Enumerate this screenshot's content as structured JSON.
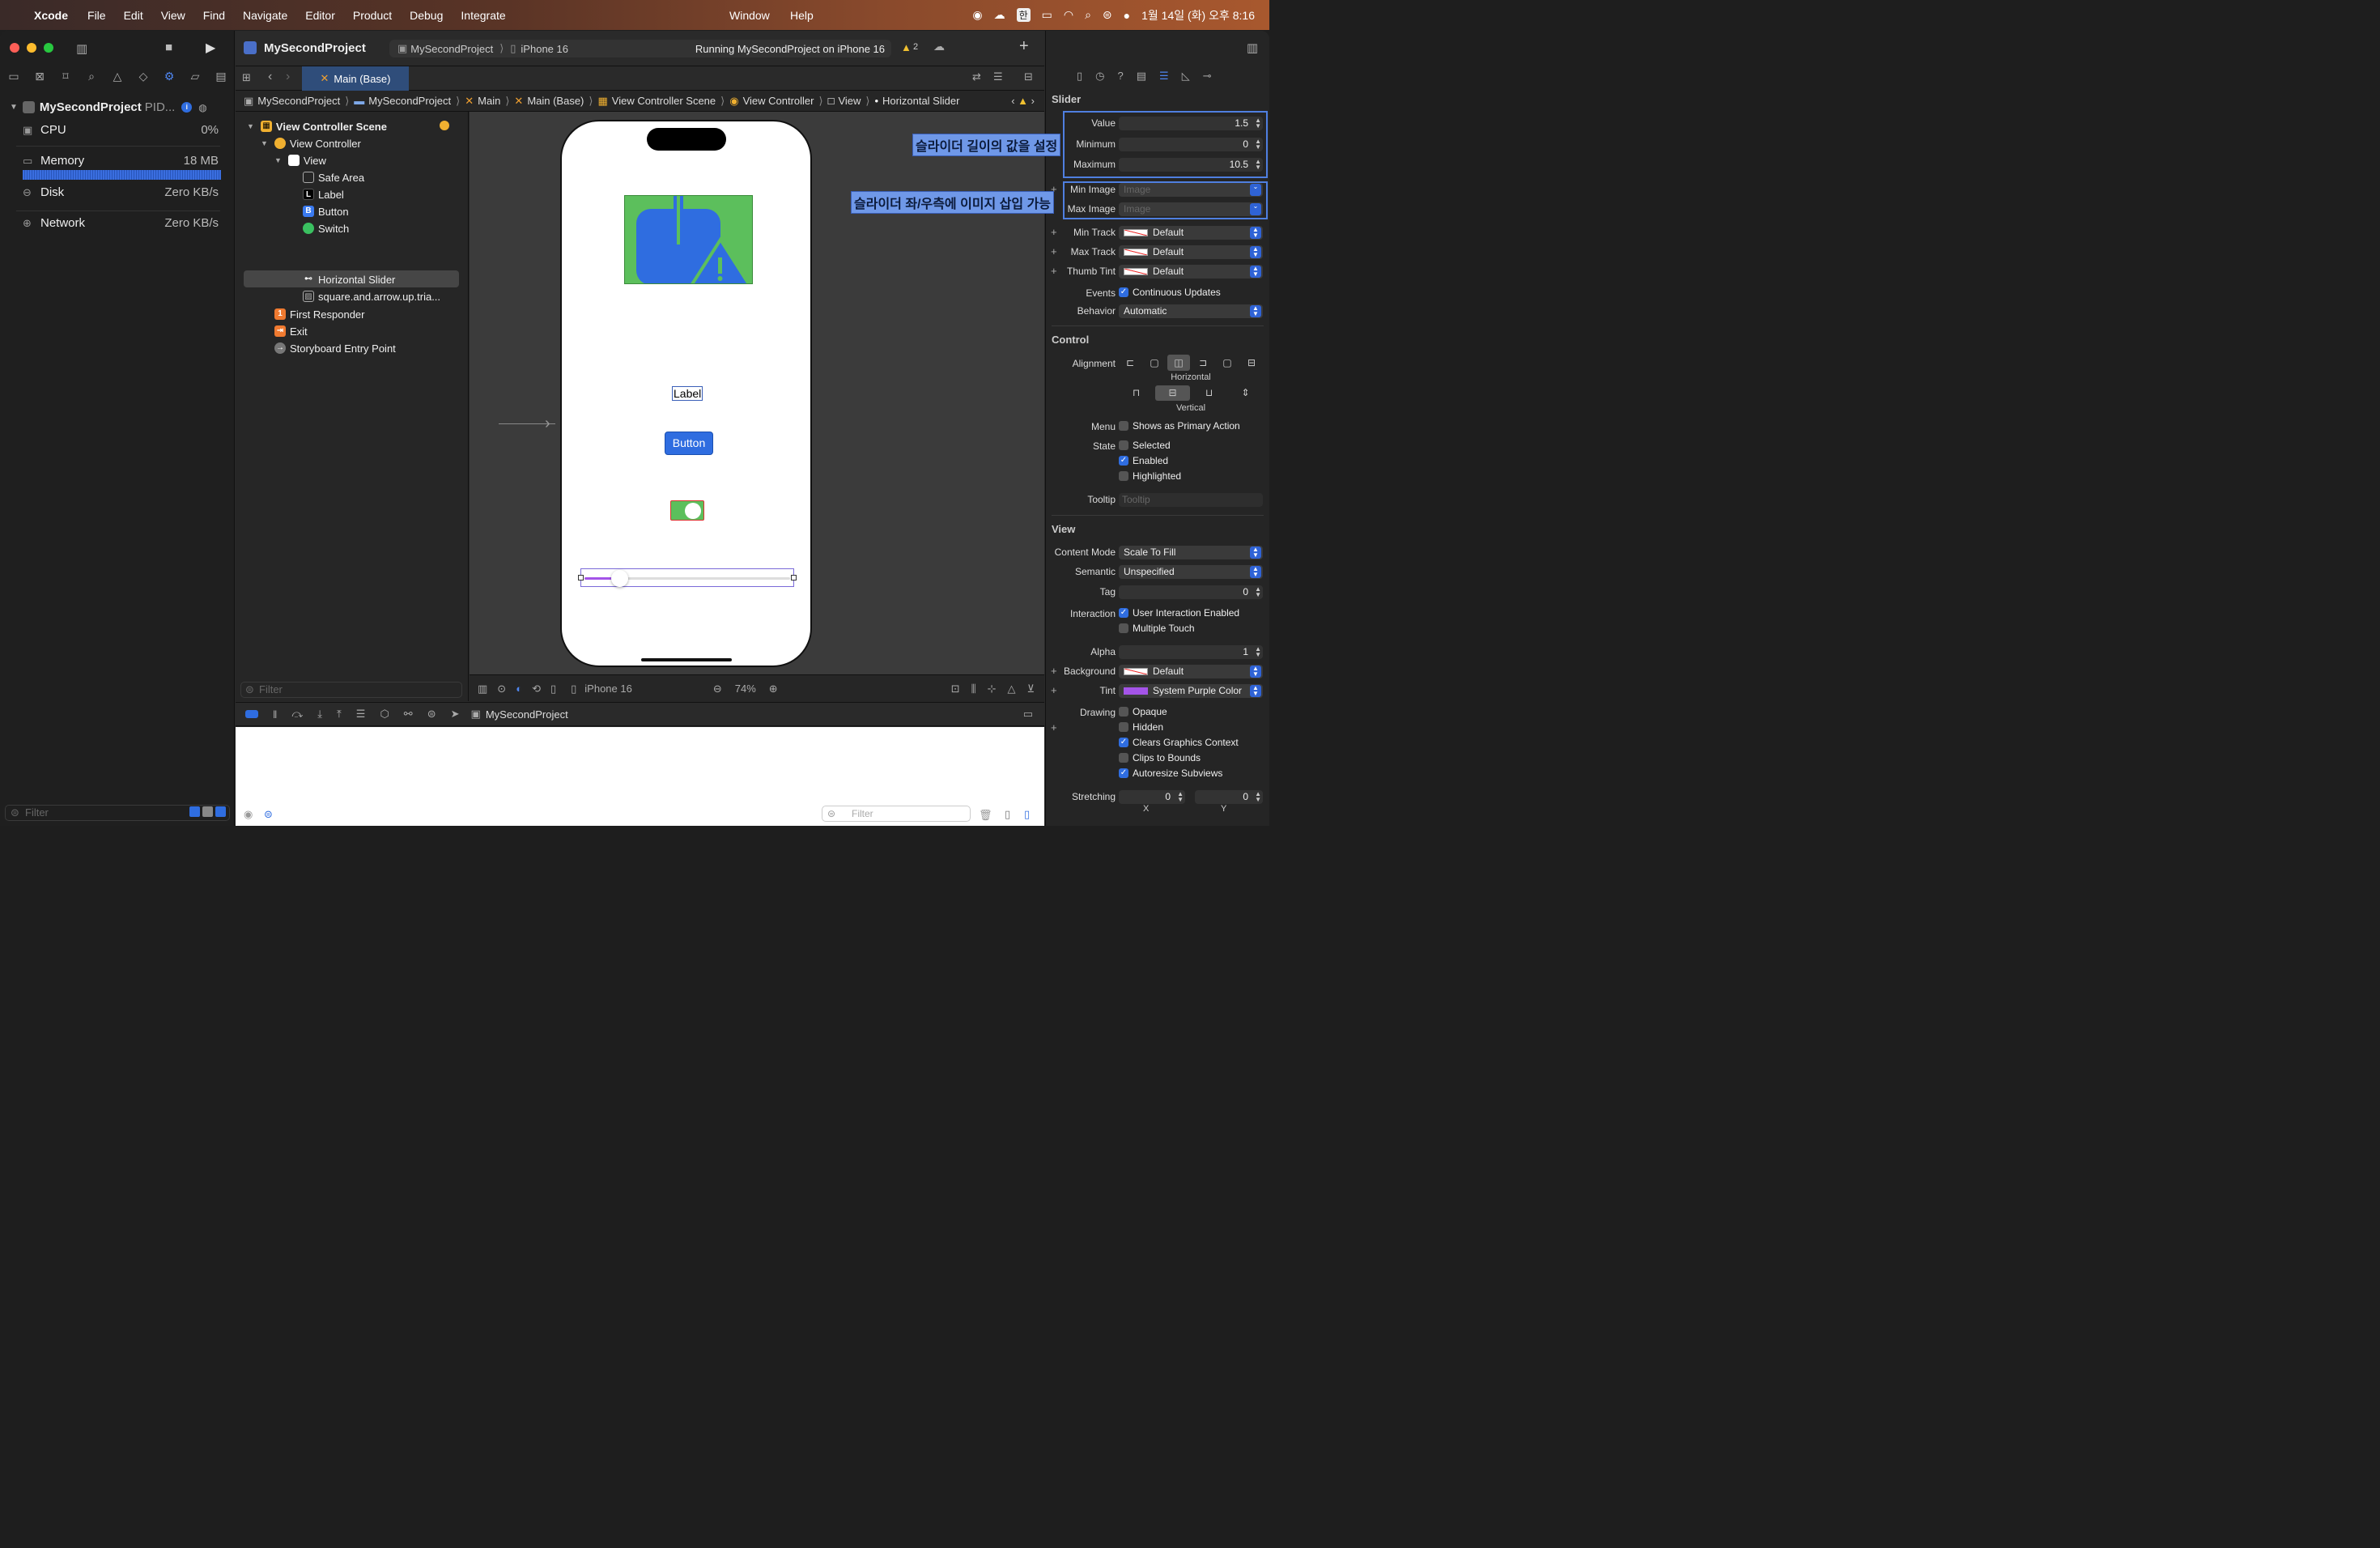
{
  "menubar": {
    "app": "Xcode",
    "items": [
      "File",
      "Edit",
      "View",
      "Find",
      "Navigate",
      "Editor",
      "Product",
      "Debug",
      "Integrate"
    ],
    "right_items": [
      "Window",
      "Help"
    ],
    "input_source": "한",
    "datetime": "1월 14일 (화) 오후 8:16"
  },
  "left": {
    "project": "MySecondProject",
    "pid": "PID...",
    "cpu_label": "CPU",
    "cpu_value": "0%",
    "memory_label": "Memory",
    "memory_value": "18 MB",
    "disk_label": "Disk",
    "disk_value": "Zero KB/s",
    "network_label": "Network",
    "network_value": "Zero KB/s",
    "filter_placeholder": "Filter"
  },
  "toolbar": {
    "project": "MySecondProject",
    "scheme": "MySecondProject",
    "device": "iPhone 16",
    "status": "Running MySecondProject on iPhone 16",
    "warnings": "2"
  },
  "tab": {
    "label": "Main (Base)"
  },
  "jumpbar": [
    "MySecondProject",
    "MySecondProject",
    "Main",
    "Main (Base)",
    "View Controller Scene",
    "View Controller",
    "View",
    "Horizontal Slider"
  ],
  "outline": {
    "scene": "View Controller Scene",
    "vc": "View Controller",
    "view": "View",
    "safe_area": "Safe Area",
    "label": "Label",
    "button": "Button",
    "switch": "Switch",
    "slider": "Horizontal Slider",
    "image": "square.and.arrow.up.tria...",
    "first_responder": "First Responder",
    "exit": "Exit",
    "entry": "Storyboard Entry Point",
    "filter_placeholder": "Filter"
  },
  "canvas": {
    "label_text": "Label",
    "button_text": "Button",
    "device": "iPhone 16",
    "zoom": "74%"
  },
  "debug": {
    "process": "MySecondProject",
    "filter_placeholder": "Filter"
  },
  "inspector": {
    "slider_section": "Slider",
    "value_label": "Value",
    "value": "1.5",
    "min_label": "Minimum",
    "min": "0",
    "max_label": "Maximum",
    "max": "10.5",
    "min_image_label": "Min Image",
    "max_image_label": "Max Image",
    "image_placeholder": "Image",
    "min_track_label": "Min Track",
    "max_track_label": "Max Track",
    "thumb_tint_label": "Thumb Tint",
    "default": "Default",
    "events_label": "Events",
    "continuous": "Continuous Updates",
    "behavior_label": "Behavior",
    "behavior": "Automatic",
    "control_section": "Control",
    "alignment_label": "Alignment",
    "horizontal": "Horizontal",
    "vertical": "Vertical",
    "menu_label": "Menu",
    "primary_action": "Shows as Primary Action",
    "state_label": "State",
    "selected": "Selected",
    "enabled": "Enabled",
    "highlighted": "Highlighted",
    "tooltip_label": "Tooltip",
    "tooltip_placeholder": "Tooltip",
    "view_section": "View",
    "content_mode_label": "Content Mode",
    "content_mode": "Scale To Fill",
    "semantic_label": "Semantic",
    "semantic": "Unspecified",
    "tag_label": "Tag",
    "tag": "0",
    "interaction_label": "Interaction",
    "user_interaction": "User Interaction Enabled",
    "multi_touch": "Multiple Touch",
    "alpha_label": "Alpha",
    "alpha": "1",
    "background_label": "Background",
    "tint_label": "Tint",
    "tint": "System Purple Color",
    "drawing_label": "Drawing",
    "opaque": "Opaque",
    "hidden": "Hidden",
    "clears": "Clears Graphics Context",
    "clips": "Clips to Bounds",
    "autoresize": "Autoresize Subviews",
    "stretching_label": "Stretching",
    "stretch_x": "0",
    "stretch_y": "0",
    "x_label": "X",
    "y_label": "Y"
  },
  "annotations": {
    "range": "슬라이더 길이의 값을 설정",
    "images": "슬라이더 좌/우측에 이미지 삽입 가능"
  },
  "colors": {
    "accent": "#2f6de0",
    "tint_purple": "#a454e8",
    "image_green": "#5cbf5c",
    "image_blue": "#2f6de0"
  }
}
